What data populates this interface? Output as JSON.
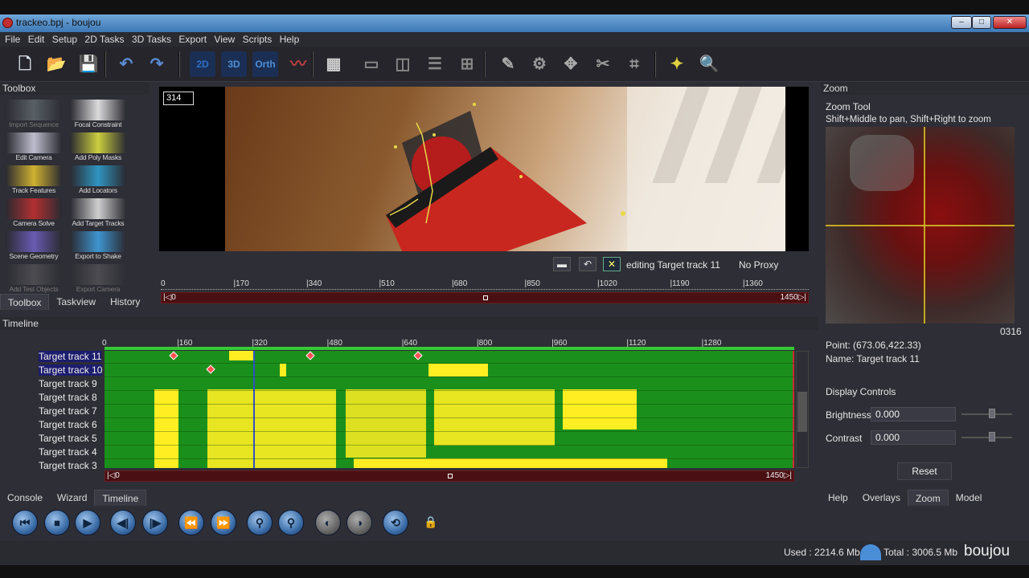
{
  "window": {
    "title": "trackeo.bpj - boujou",
    "min": "–",
    "max": "□",
    "close": "✕"
  },
  "menu": [
    "File",
    "Edit",
    "Setup",
    "2D Tasks",
    "3D Tasks",
    "Export",
    "View",
    "Scripts",
    "Help"
  ],
  "toolbar": {
    "buttons": [
      {
        "name": "new-file-icon",
        "glyph": "🗋"
      },
      {
        "name": "open-folder-icon",
        "glyph": "📂"
      },
      {
        "name": "save-icon",
        "glyph": "💾"
      },
      {
        "name": "undo-icon",
        "glyph": "↶"
      },
      {
        "name": "redo-icon",
        "glyph": "↷"
      },
      {
        "name": "view-2d-button",
        "glyph": "2D"
      },
      {
        "name": "view-3d-button",
        "glyph": "3D"
      },
      {
        "name": "view-orth-button",
        "glyph": "Orth"
      },
      {
        "name": "graph-view-icon",
        "glyph": "〰"
      },
      {
        "name": "grid-view-icon",
        "glyph": "▦"
      },
      {
        "name": "layout-single-icon",
        "glyph": "▭"
      },
      {
        "name": "layout-split-icon",
        "glyph": "◫"
      },
      {
        "name": "layout-stack-icon",
        "glyph": "☰"
      },
      {
        "name": "layout-quad-icon",
        "glyph": "⊞"
      },
      {
        "name": "tool-a-icon",
        "glyph": "✎"
      },
      {
        "name": "tool-b-icon",
        "glyph": "⚙"
      },
      {
        "name": "tool-c-icon",
        "glyph": "✥"
      },
      {
        "name": "tool-d-icon",
        "glyph": "✂"
      },
      {
        "name": "select-region-icon",
        "glyph": "⌗"
      },
      {
        "name": "hint-icon",
        "glyph": "✦"
      },
      {
        "name": "zoom-icon",
        "glyph": "🔍"
      }
    ]
  },
  "toolbox": {
    "title": "Toolbox",
    "tools": [
      {
        "label": "Import Sequence",
        "dim": true
      },
      {
        "label": "Focal Constraint",
        "dim": false
      },
      {
        "label": "Edit Camera",
        "dim": false
      },
      {
        "label": "Add Poly Masks",
        "dim": false
      },
      {
        "label": "Track Features",
        "dim": false
      },
      {
        "label": "Add Locators",
        "dim": false
      },
      {
        "label": "Camera Solve",
        "dim": false
      },
      {
        "label": "Add Target Tracks",
        "dim": false
      },
      {
        "label": "Scene Geometry",
        "dim": false
      },
      {
        "label": "Export to Shake",
        "dim": false
      },
      {
        "label": "Add Test Objects",
        "dim": true
      },
      {
        "label": "Export Camera",
        "dim": true
      }
    ],
    "tabs": [
      "Toolbox",
      "Taskview",
      "History"
    ]
  },
  "viewer": {
    "frame": "314",
    "editing": "editing Target track 11",
    "proxy": "No Proxy",
    "ruler": [
      "0",
      "|170",
      "|340",
      "|510",
      "|680",
      "|850",
      "|1020",
      "|1190",
      "|1360"
    ],
    "range_start": "|◁0",
    "range_end": "1450▷|"
  },
  "timeline": {
    "title": "Timeline",
    "ruler": [
      "0",
      "|160",
      "|320",
      "|480",
      "|640",
      "|800",
      "|960",
      "|1120",
      "|1280"
    ],
    "tracks": [
      "Target track 11",
      "Target track 10",
      "Target track 9",
      "Target track 8",
      "Target track 7",
      "Target track 6",
      "Target track 5",
      "Target track 4",
      "Target track 3"
    ],
    "selected": [
      0,
      1
    ],
    "range_start": "|◁0",
    "range_end": "1450▷|",
    "tabs": [
      "Console",
      "Wizard",
      "Timeline"
    ]
  },
  "zoom": {
    "title": "Zoom",
    "tool": "Zoom Tool",
    "hint": "Shift+Middle to pan, Shift+Right to zoom",
    "frame": "0316",
    "point": "Point: (673.06,422.33)",
    "name": "Name: Target track 11",
    "display_controls": "Display Controls",
    "brightness_label": "Brightness",
    "brightness": "0.000",
    "contrast_label": "Contrast",
    "contrast": "0.000",
    "reset": "Reset",
    "tabs": [
      "Help",
      "Overlays",
      "Zoom",
      "Model"
    ]
  },
  "transport": [
    "⏮",
    "⏹",
    "▶",
    "◀|",
    "|▶",
    "⏪",
    "⏩",
    "⚲",
    "⚲",
    "◐",
    "◑",
    "⟲",
    "🔒"
  ],
  "status": {
    "used": "Used : 2214.6 Mb",
    "total": "Total : 3006.5 Mb",
    "brand": "boujou"
  }
}
